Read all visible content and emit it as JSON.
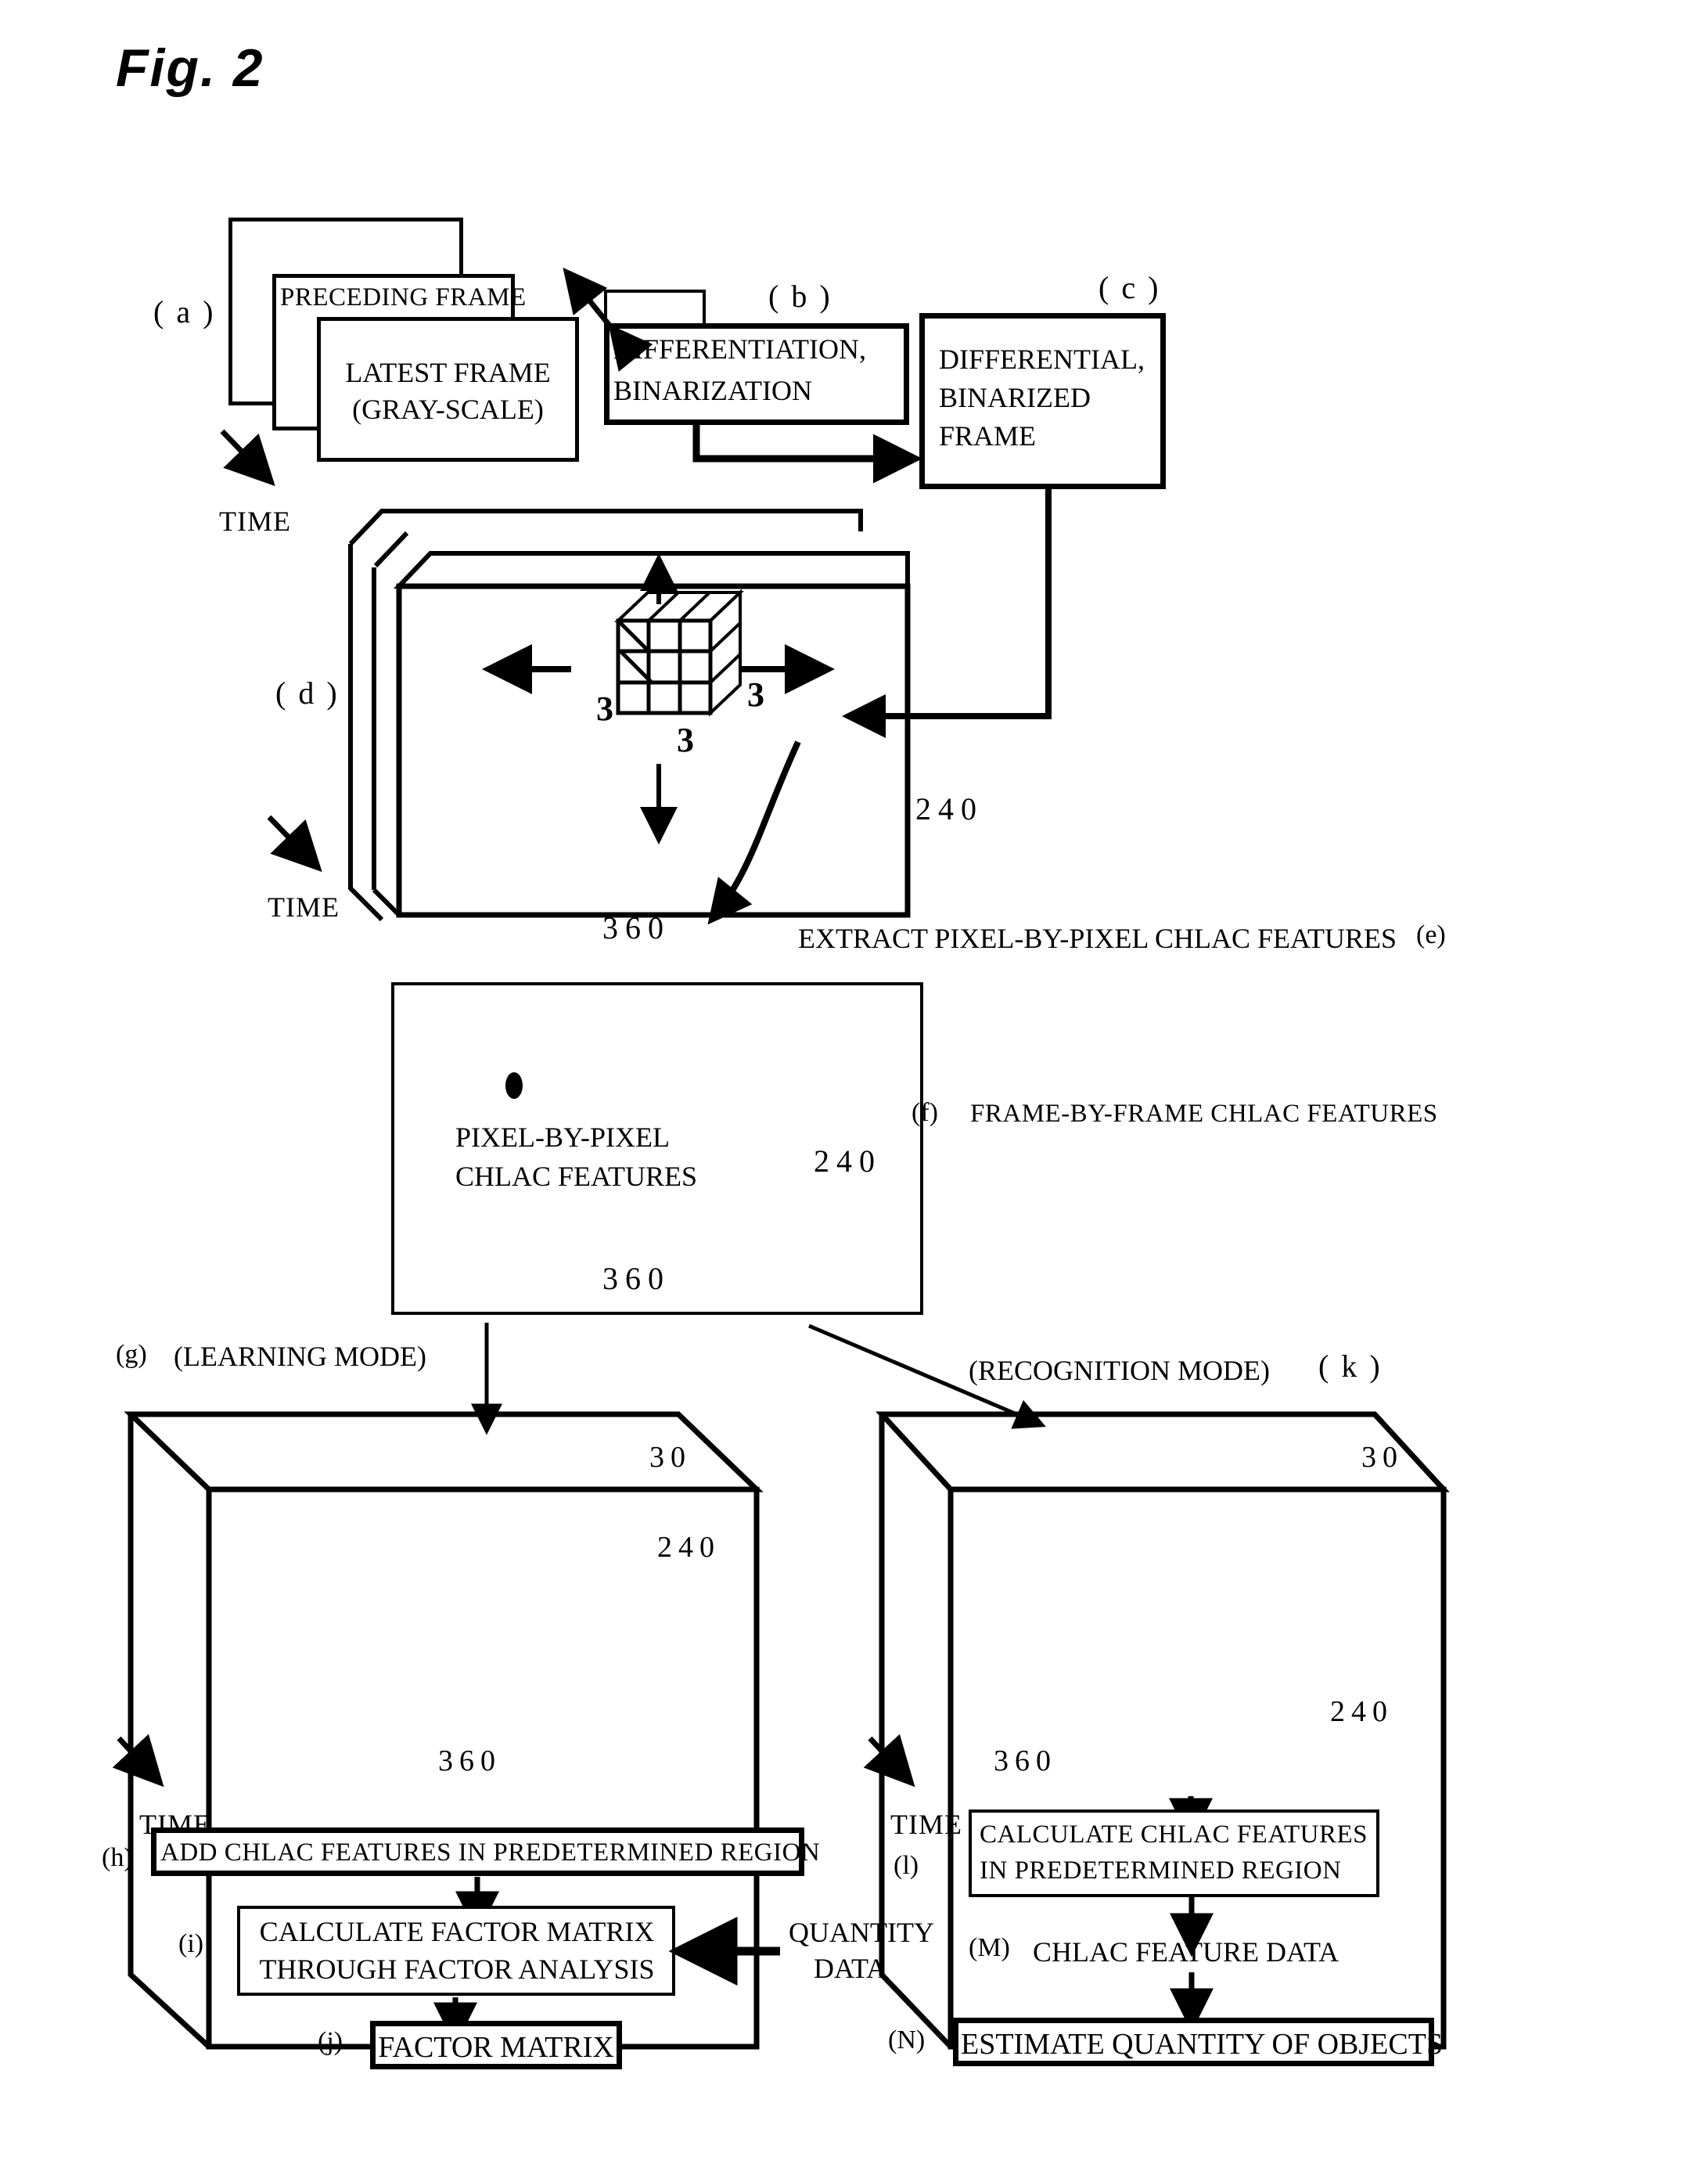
{
  "figure": {
    "title": "Fig. 2"
  },
  "stage_a": {
    "ref": "( a )",
    "preceding_frame": "PRECEDING FRAME",
    "latest_frame_line1": "LATEST FRAME",
    "latest_frame_line2": "(GRAY-SCALE)",
    "time_label": "TIME"
  },
  "stage_b": {
    "ref": "( b )",
    "line1": "DIFFERENTIATION,",
    "line2": "BINARIZATION"
  },
  "stage_c": {
    "ref": "( c )",
    "line1": "DIFFERENTIAL,",
    "line2": "BINARIZED",
    "line3": "FRAME"
  },
  "stage_d": {
    "ref": "( d )",
    "time_label": "TIME",
    "mask_size_right": "3",
    "mask_size_left": "3",
    "mask_size_bottom": "3",
    "height": "240",
    "width": "360"
  },
  "stage_e": {
    "ref": "(e)",
    "label": "EXTRACT PIXEL-BY-PIXEL CHLAC FEATURES"
  },
  "stage_f": {
    "ref": "(f)",
    "label": "FRAME-BY-FRAME CHLAC FEATURES",
    "inner_line1": "PIXEL-BY-PIXEL",
    "inner_line2": "CHLAC FEATURES",
    "height": "240",
    "width": "360"
  },
  "stage_g": {
    "ref": "(g)",
    "mode": "(LEARNING MODE)",
    "depth": "30",
    "height": "240",
    "width": "360",
    "time_label": "TIME"
  },
  "stage_k": {
    "ref": "( k )",
    "mode": "(RECOGNITION MODE)",
    "depth": "30",
    "height": "240",
    "width": "360",
    "time_label": "TIME"
  },
  "stage_h": {
    "ref": "(h)",
    "label": "ADD CHLAC FEATURES IN PREDETERMINED REGION"
  },
  "stage_i": {
    "ref": "(i)",
    "line1": "CALCULATE FACTOR MATRIX",
    "line2": "THROUGH FACTOR ANALYSIS"
  },
  "stage_j": {
    "ref": "(j)",
    "label": "FACTOR MATRIX"
  },
  "quantity_data": {
    "line1": "QUANTITY",
    "line2": "DATA"
  },
  "stage_l": {
    "ref": "(l)",
    "line1": "CALCULATE CHLAC FEATURES",
    "line2": "IN PREDETERMINED REGION"
  },
  "stage_m": {
    "ref": "(M)",
    "label": "CHLAC FEATURE DATA"
  },
  "stage_n": {
    "ref": "(N)",
    "label": "ESTIMATE QUANTITY OF OBJECTS"
  }
}
